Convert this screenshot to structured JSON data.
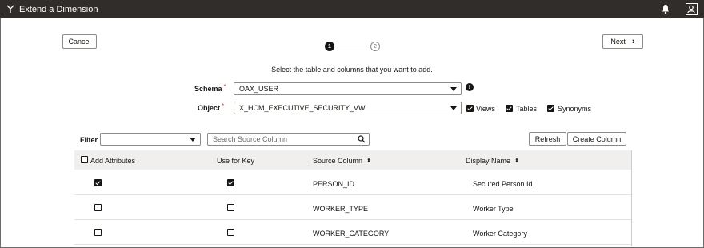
{
  "titlebar": {
    "title": "Extend a Dimension",
    "app_icon": "branch-icon",
    "bell_icon": "bell-icon",
    "user_icon": "user-icon"
  },
  "nav": {
    "cancel_label": "Cancel",
    "next_label": "Next",
    "next_chevron": "›"
  },
  "stepper": {
    "step1": "1",
    "step2": "2",
    "current": 1
  },
  "instruction": "Select the table and columns that you want to add.",
  "schema": {
    "label": "Schema",
    "required": "*",
    "value": "OAX_USER"
  },
  "object": {
    "label": "Object",
    "required": "*",
    "value": "X_HCM_EXECUTIVE_SECURITY_VW"
  },
  "object_types": [
    {
      "label": "Views",
      "checked": true
    },
    {
      "label": "Tables",
      "checked": true
    },
    {
      "label": "Synonyms",
      "checked": true
    }
  ],
  "filter": {
    "label": "Filter",
    "value": ""
  },
  "search": {
    "placeholder": "Search Source Column"
  },
  "actions": {
    "refresh_label": "Refresh",
    "create_column_label": "Create Column"
  },
  "table": {
    "headers": {
      "add_attributes": "Add Attributes",
      "use_for_key": "Use for Key",
      "source_column": "Source Column",
      "display_name": "Display Name"
    },
    "add_all_checked": false,
    "rows": [
      {
        "add": true,
        "key": true,
        "source_column": "PERSON_ID",
        "display_name": "Secured Person Id"
      },
      {
        "add": false,
        "key": false,
        "source_column": "WORKER_TYPE",
        "display_name": "Worker Type"
      },
      {
        "add": false,
        "key": false,
        "source_column": "WORKER_CATEGORY",
        "display_name": "Worker Category"
      }
    ]
  },
  "colors": {
    "titlebar_bg": "#312d2a",
    "required": "#c74634",
    "header_bg": "#f1efed"
  }
}
